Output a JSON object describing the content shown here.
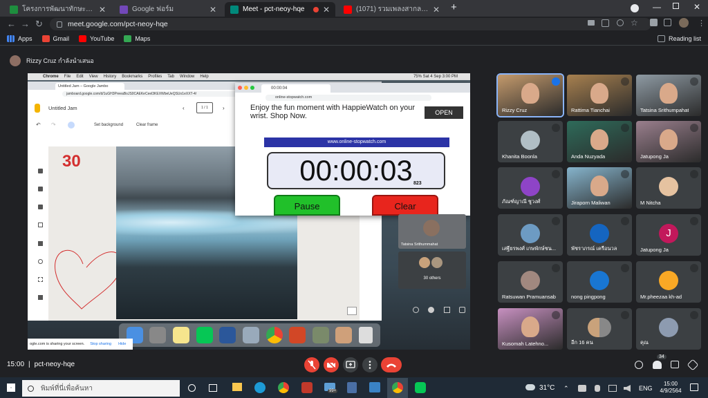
{
  "browser": {
    "tabs": [
      {
        "title": "โครงการพัฒนาทักษะภาษาอังกฤษเพื่อ",
        "color": "#1e8e3e"
      },
      {
        "title": "Google ฟอร์ม",
        "color": "#7248b9"
      },
      {
        "title": "Meet - pct-neoy-hqe",
        "color": "#00897b",
        "active": true
      },
      {
        "title": "(1071) รวมเพลงสากล(ไม่มีโฆษณา) เ",
        "color": "#ff0000"
      }
    ],
    "url": "meet.google.com/pct-neoy-hqe",
    "bookmarks": [
      "Apps",
      "Gmail",
      "YouTube",
      "Maps"
    ],
    "reading_list": "Reading list"
  },
  "meet": {
    "presenter_text": "Rizzy Cruz กำลังนำเสนอ",
    "time": "15:00",
    "meeting_code": "pct-neoy-hqe",
    "participant_count": "34",
    "tiles": [
      {
        "name": "Rizzy Cruz",
        "kind": "photo",
        "color": "#c49a6c"
      },
      {
        "name": "Rattima Tianchai",
        "kind": "photo",
        "color": "#a7804f"
      },
      {
        "name": "Tatsina Srithumpahat",
        "kind": "photo",
        "color": "#8e9aa3"
      },
      {
        "name": "Khanita Boonla",
        "kind": "avatar",
        "color": "#b0bec5"
      },
      {
        "name": "Anda Nuzyada",
        "kind": "photo",
        "color": "#2e6b5a"
      },
      {
        "name": "Jatupong Ja",
        "kind": "photo",
        "color": "#9a7f8d"
      },
      {
        "name": "ภัณฑ์ญาณี ชูวงศ์",
        "kind": "avatar",
        "color": "#8e44c7"
      },
      {
        "name": "Jiraporn Maliwan",
        "kind": "photo",
        "color": "#86b4cc"
      },
      {
        "name": "M Nitcha",
        "kind": "avatar",
        "color": "#e5c2a0"
      },
      {
        "name": "เสฐียรพงศ์ เกษพักษ์ชน...",
        "kind": "avatar",
        "color": "#6d9bc3"
      },
      {
        "name": "พัชราภรณ์ เครือนวล",
        "kind": "avatar",
        "color": "#1565c0"
      },
      {
        "name": "Jatupong Ja",
        "kind": "letter",
        "letter": "J",
        "color": "#c2185b"
      },
      {
        "name": "Ratsuwan Pramuansab",
        "kind": "avatar",
        "color": "#a1887f"
      },
      {
        "name": "nong pingpong",
        "kind": "avatar",
        "color": "#1976d2"
      },
      {
        "name": "Mr.pheezaa kh-ad",
        "kind": "avatar",
        "color": "#f9a825"
      },
      {
        "name": "Kusomah Latehno...",
        "kind": "photo",
        "color": "#c790c0"
      },
      {
        "name": "อีก 16 คน",
        "kind": "group",
        "color": "#9e9e9e"
      },
      {
        "name": "คุณ",
        "kind": "avatar",
        "color": "#8d9bb0"
      }
    ],
    "side_tiles": [
      {
        "name": "Tatsina Srithummahat"
      },
      {
        "name": "30 others"
      }
    ]
  },
  "shared": {
    "mac_menu": [
      "Chrome",
      "File",
      "Edit",
      "View",
      "History",
      "Bookmarks",
      "Profiles",
      "Tab",
      "Window",
      "Help"
    ],
    "mac_status": "75%  Sat 4 Sep  3:00 PM",
    "jam_tab": "Untitled Jam – Google Jambo",
    "jam_url": "jamboard.google.com/d/1uGH3PreeaBoJS0CAEKeCeel3KEXWbeUeQSUo1eXXT-4/",
    "jam_title": "Untitled Jam",
    "jam_page": "1 / 1",
    "jam_set_bg": "Set background",
    "jam_clear": "Clear frame",
    "jam_number": "30",
    "sw_tab": "00:00:04",
    "sw_url": "online-stopwatch.com",
    "ad_text": "Enjoy the fun moment with HappieWatch on your wrist. Shop Now.",
    "ad_button": "OPEN",
    "sw_banner": "www.online-stopwatch.com",
    "sw_time": "00:00:03",
    "sw_ms": "823",
    "pause": "Pause",
    "clear": "Clear",
    "sharing_text": "ogle.com is sharing your screen.",
    "stop_sharing": "Stop sharing",
    "hide": "Hide"
  },
  "taskbar": {
    "search_placeholder": "พิมพ์ที่นี่เพื่อค้นหา",
    "weather": "31°C",
    "lang": "ENG",
    "clock_time": "15:00",
    "clock_date": "4/9/2564",
    "mail_badge": "99+"
  }
}
